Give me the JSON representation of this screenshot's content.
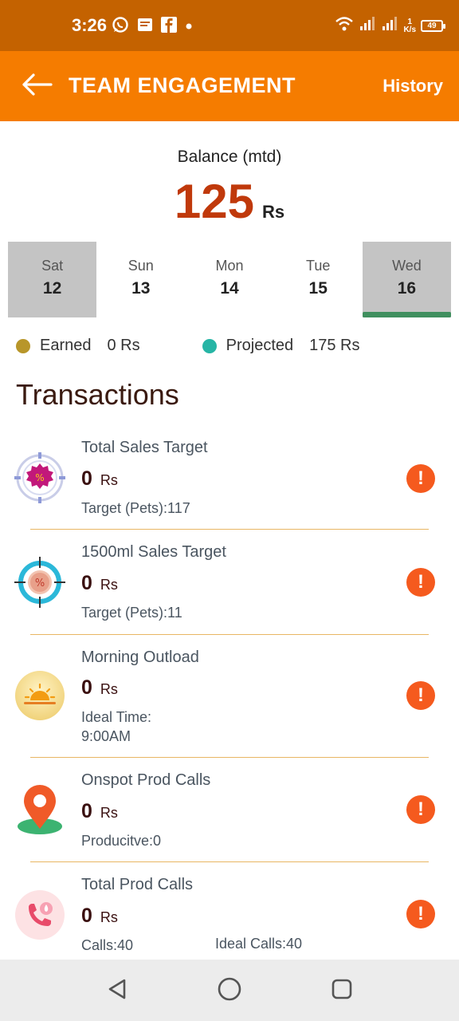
{
  "status_bar": {
    "time": "3:26",
    "net_speed_value": "1",
    "net_speed_unit": "K/s",
    "battery": "49"
  },
  "app_bar": {
    "title": "TEAM ENGAGEMENT",
    "history_label": "History"
  },
  "balance": {
    "label": "Balance (mtd)",
    "value": "125",
    "unit": "Rs"
  },
  "days": [
    {
      "name": "Sat",
      "num": "12",
      "selected": true
    },
    {
      "name": "Sun",
      "num": "13",
      "selected": false
    },
    {
      "name": "Mon",
      "num": "14",
      "selected": false
    },
    {
      "name": "Tue",
      "num": "15",
      "selected": false
    },
    {
      "name": "Wed",
      "num": "16",
      "selected": true
    }
  ],
  "legend": {
    "earned_label": "Earned",
    "earned_value": "0 Rs",
    "earned_color": "#b8962a",
    "projected_label": "Projected",
    "projected_value": "175 Rs",
    "projected_color": "#26b5a5"
  },
  "section_title": "Transactions",
  "transactions": [
    {
      "title": "Total Sales Target",
      "amount": "0",
      "unit": "Rs",
      "sub": "Target (Pets):117",
      "icon": "target-percent-icon"
    },
    {
      "title": "1500ml Sales Target",
      "amount": "0",
      "unit": "Rs",
      "sub": "Target (Pets):11",
      "icon": "crosshair-percent-icon"
    },
    {
      "title": "Morning Outload",
      "amount": "0",
      "unit": "Rs",
      "sub_line1": "Ideal Time:",
      "sub_line2": "9:00AM",
      "icon": "sunrise-icon"
    },
    {
      "title": "Onspot Prod Calls",
      "amount": "0",
      "unit": "Rs",
      "sub": "Producitve:0",
      "icon": "location-pin-icon"
    },
    {
      "title": "Total Prod Calls",
      "amount": "0",
      "unit": "Rs",
      "sub": "Calls:40",
      "sub2": "Ideal Calls:40",
      "icon": "phone-call-icon"
    }
  ],
  "alert_glyph": "!"
}
